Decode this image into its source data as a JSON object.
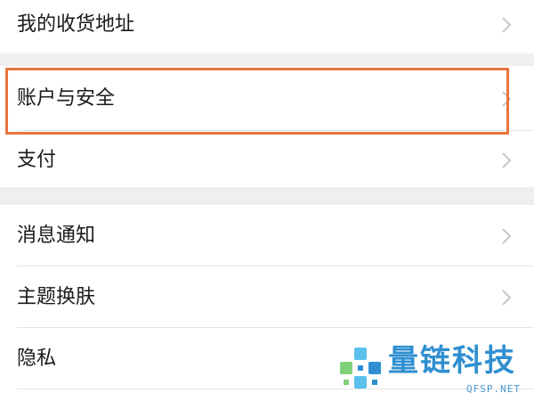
{
  "settings": {
    "items": [
      {
        "label": "我的收货地址",
        "icon": "chevron-right-icon"
      },
      {
        "label": "账户与安全",
        "icon": "chevron-right-icon"
      },
      {
        "label": "支付",
        "icon": "chevron-right-icon"
      },
      {
        "label": "消息通知",
        "icon": "chevron-right-icon"
      },
      {
        "label": "主题换肤",
        "icon": "chevron-right-icon"
      },
      {
        "label": "隐私",
        "icon": "chevron-right-icon"
      }
    ],
    "highlighted_item": "账户与安全"
  },
  "watermark": {
    "brand": "量链科技",
    "url": "QFSP.NET"
  },
  "colors": {
    "highlight": "#e8743f",
    "section_gap": "#efefef",
    "chevron": "#c7c7c7",
    "watermark": "#2f8fd0"
  }
}
